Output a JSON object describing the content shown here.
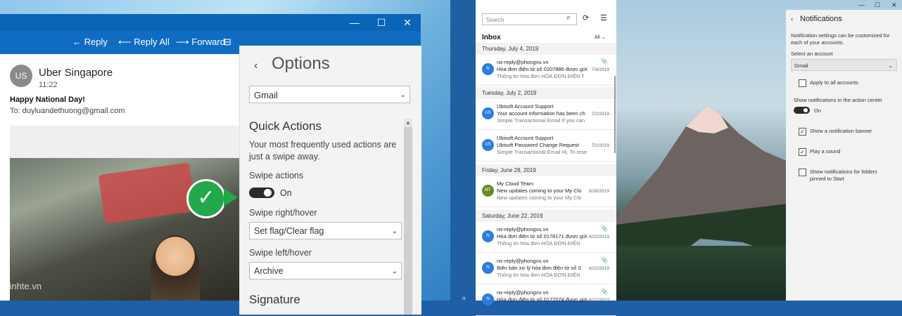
{
  "mail_window": {
    "controls": [
      "—",
      "☐",
      "✕"
    ],
    "toolbar": {
      "reply": "← Reply",
      "reply_all": "⟵ Reply All",
      "forward": "⟶ Forward",
      "more": "⊟"
    },
    "message": {
      "avatar": "US",
      "sender": "Uber Singapore",
      "time": "11:22",
      "subject": "Happy National Day!",
      "to": "To: duyluandethuong@gmail.com",
      "watermark": "Tinhte.vn"
    }
  },
  "options": {
    "back": "‹",
    "title": "Options",
    "account": "Gmail",
    "quick_actions_title": "Quick Actions",
    "quick_actions_desc": "Your most frequently used actions are just a swipe away.",
    "swipe_actions_label": "Swipe actions",
    "swipe_actions_state": "On",
    "swipe_right_label": "Swipe right/hover",
    "swipe_right_value": "Set flag/Clear flag",
    "swipe_left_label": "Swipe left/hover",
    "swipe_left_value": "Archive",
    "signature_title": "Signature"
  },
  "mail_list": {
    "search_placeholder": "Search",
    "inbox_label": "Inbox",
    "filter": "All ⌄",
    "groups": [
      {
        "date": "Thursday, July 4, 2019"
      },
      {
        "date": "Tuesday, July 2, 2019"
      },
      {
        "date": "Friday, June 28, 2019"
      },
      {
        "date": "Saturday, June 22, 2019"
      }
    ],
    "items": [
      {
        "avatar": "N",
        "color": "#2b7de0",
        "from": "no-reply@phongvu.vn",
        "subject": "Hóa đơn điện tử số 0207886 được gửi",
        "preview": "Thông tin hóa đơn HÓA ĐƠN ĐIỆN T",
        "date": "7/4/2019",
        "clip": "📎"
      },
      {
        "avatar": "US",
        "color": "#2b7de0",
        "from": "Ubisoft Account Support",
        "subject": "Your account information has been ch",
        "preview": "Simple Transactional Email If you can",
        "date": "7/2/2019",
        "clip": ""
      },
      {
        "avatar": "US",
        "color": "#2b7de0",
        "from": "Ubisoft Account Support",
        "subject": "Ubisoft Password Change Request",
        "preview": "Simple Transactional Email Hi, To rese",
        "date": "7/2/2019",
        "clip": ""
      },
      {
        "avatar": "MT",
        "color": "#6a8a2a",
        "from": "My Cloud Team",
        "subject": "New updates coming to your My Clo",
        "preview": "New updates coming to your My Clo",
        "date": "6/28/2019",
        "clip": ""
      },
      {
        "avatar": "N",
        "color": "#2b7de0",
        "from": "no-reply@phongvu.vn",
        "subject": "Hóa đơn điện tử số 0178171 được gửi",
        "preview": "Thông tin hóa đơn HÓA ĐƠN ĐIỆN",
        "date": "6/22/2019",
        "clip": "📎"
      },
      {
        "avatar": "N",
        "color": "#2b7de0",
        "from": "no-reply@phongvu.vn",
        "subject": "Biên bản xử lý hóa đơn điện tử số 0",
        "preview": "Thông tin hóa đơn HÓA ĐƠN ĐIỆN",
        "date": "6/22/2019",
        "clip": "📎"
      },
      {
        "avatar": "N",
        "color": "#2b7de0",
        "from": "no-reply@phongvu.vn",
        "subject": "Hóa đơn điện tử số 0177074 được gửi",
        "preview": "",
        "date": "6/22/2019",
        "clip": "📎"
      }
    ]
  },
  "notifications": {
    "controls": [
      "—",
      "☐",
      "✕"
    ],
    "back": "‹",
    "title": "Notifications",
    "desc": "Notification settings can be customized for each of your accounts.",
    "select_label": "Select an account",
    "select_value": "Gmail",
    "apply_all": "Apply to all accounts",
    "show_label": "Show notifications in the action center",
    "toggle_state": "On",
    "banner": "Show a notification banner",
    "sound": "Play a sound",
    "folders": "Show notifications for folders pinned to Start",
    "check": "✓"
  },
  "taskbar": {
    "dot": "ıı"
  }
}
